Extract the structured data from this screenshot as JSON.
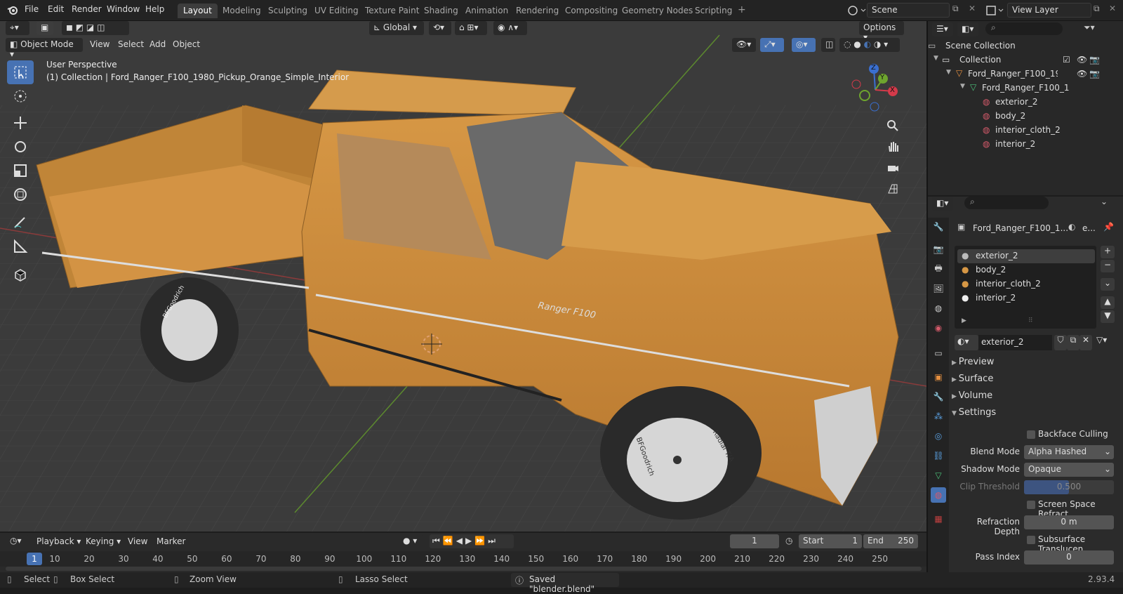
{
  "top_menu": [
    "File",
    "Edit",
    "Render",
    "Window",
    "Help"
  ],
  "workspaces": [
    "Layout",
    "Modeling",
    "Sculpting",
    "UV Editing",
    "Texture Paint",
    "Shading",
    "Animation",
    "Rendering",
    "Compositing",
    "Geometry Nodes",
    "Scripting"
  ],
  "active_workspace": "Layout",
  "scene_name": "Scene",
  "view_layer": "View Layer",
  "viewport": {
    "transform_orientation": "Global",
    "options": "Options",
    "mode": "Object Mode",
    "menus": [
      "View",
      "Select",
      "Add",
      "Object"
    ],
    "overlay_title": "User Perspective",
    "overlay_subtitle": "(1) Collection | Ford_Ranger_F100_1980_Pickup_Orange_Simple_Interior",
    "body_text": "Ranger F100",
    "tire_text_1": "BFGoodrich",
    "tire_text_2": "Radial T/A",
    "gizmo": {
      "x": "X",
      "y": "Y",
      "z": "Z"
    }
  },
  "outliner": {
    "scene_collection": "Scene Collection",
    "collection": "Collection",
    "object": "Ford_Ranger_F100_198(",
    "mesh": "Ford_Ranger_F100_1",
    "materials": [
      "exterior_2",
      "body_2",
      "interior_cloth_2",
      "interior_2"
    ]
  },
  "properties": {
    "object_name": "Ford_Ranger_F100_1...",
    "material_short": "e...",
    "slots": [
      "exterior_2",
      "body_2",
      "interior_cloth_2",
      "interior_2"
    ],
    "active_material": "exterior_2",
    "panels": {
      "preview": "Preview",
      "surface": "Surface",
      "volume": "Volume",
      "settings": "Settings"
    },
    "backface_culling": "Backface Culling",
    "blend_mode_label": "Blend Mode",
    "blend_mode": "Alpha Hashed",
    "shadow_mode_label": "Shadow Mode",
    "shadow_mode": "Opaque",
    "clip_label": "Clip Threshold",
    "clip_value": "0.500",
    "ssr": "Screen Space Refract...",
    "refraction_label": "Refraction Depth",
    "refraction_value": "0 m",
    "subsurface": "Subsurface Translucen...",
    "pass_label": "Pass Index",
    "pass_value": "0"
  },
  "timeline": {
    "menus": [
      "Playback",
      "Keying",
      "View",
      "Marker"
    ],
    "current_frame": "1",
    "start_label": "Start",
    "start_value": "1",
    "end_label": "End",
    "end_value": "250",
    "ticks": [
      "1",
      "10",
      "20",
      "30",
      "40",
      "50",
      "60",
      "70",
      "80",
      "90",
      "100",
      "110",
      "120",
      "130",
      "140",
      "150",
      "160",
      "170",
      "180",
      "190",
      "200",
      "210",
      "220",
      "230",
      "240",
      "250"
    ]
  },
  "status": {
    "select": "Select",
    "box_select": "Box Select",
    "zoom_view": "Zoom View",
    "lasso_select": "Lasso Select",
    "saved": "Saved \"blender.blend\"",
    "version": "2.93.4"
  },
  "colors": {
    "accent": "#4772b3",
    "truck": "#c98a3d",
    "grid": "#494949"
  }
}
